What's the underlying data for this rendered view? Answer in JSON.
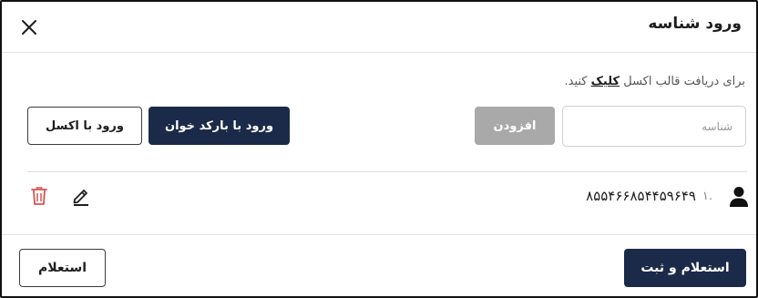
{
  "dialog": {
    "title": "ورود شناسه",
    "hint_before": "برای دریافت قالب اکسل ",
    "hint_link": "کلیک",
    "hint_after": " کنید."
  },
  "form": {
    "id_placeholder": "شناسه",
    "add_label": "افزودن",
    "barcode_label": "ورود با بارکد خوان",
    "excel_label": "ورود با اکسل"
  },
  "items": [
    {
      "index": ".۱",
      "code": "۸۵۵۴۶۶۸۵۴۴۵۹۶۴۹"
    }
  ],
  "footer": {
    "submit_label": "استعلام و ثبت",
    "inquiry_label": "استعلام"
  },
  "colors": {
    "primary": "#1b2a48",
    "disabled": "#a9a9a9",
    "delete": "#d9534f"
  }
}
